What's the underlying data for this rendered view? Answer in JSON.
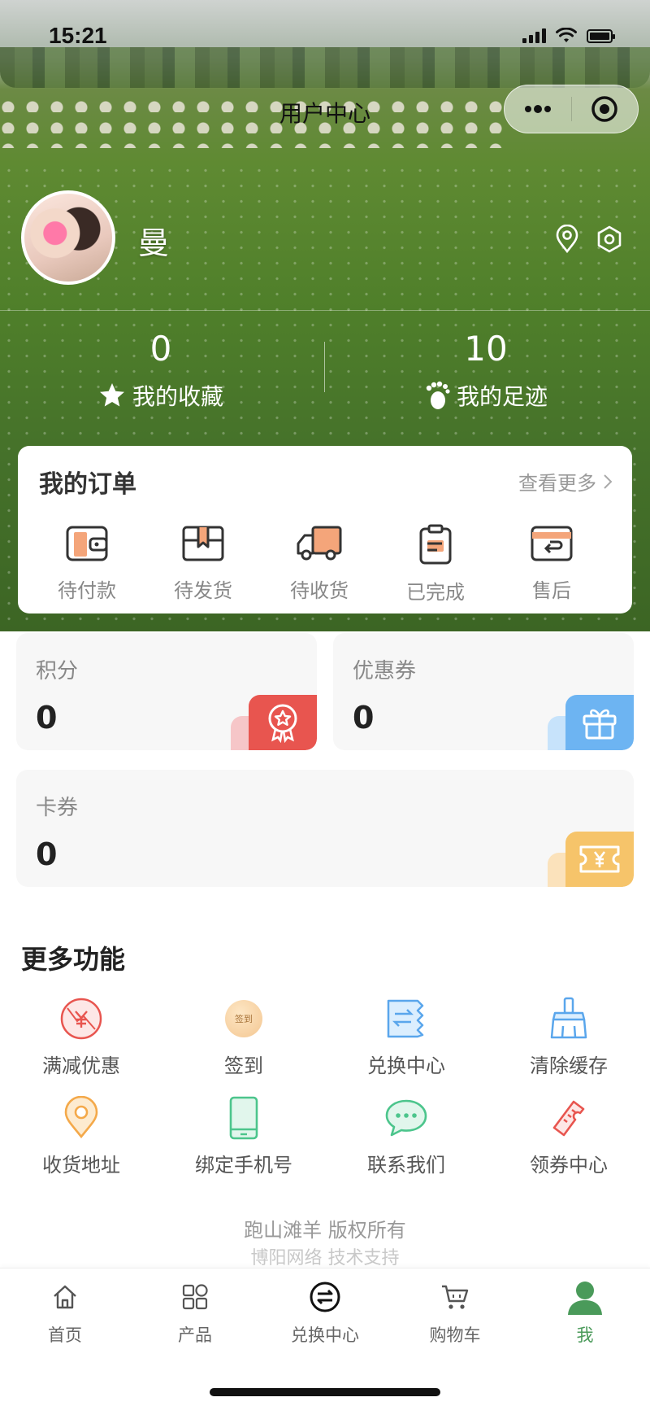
{
  "status_bar": {
    "time": "15:21"
  },
  "nav": {
    "title": "用户中心",
    "menu_icon": "more-dots-icon",
    "close_icon": "target-circle-icon"
  },
  "profile": {
    "name": "曼",
    "location_icon": "location-pin-icon",
    "settings_icon": "hexagon-gear-icon"
  },
  "stats": {
    "favorites": {
      "value": "0",
      "label": "我的收藏",
      "icon": "star-icon"
    },
    "footprints": {
      "value": "10",
      "label": "我的足迹",
      "icon": "footprint-icon"
    }
  },
  "orders": {
    "title": "我的订单",
    "more_label": "查看更多",
    "items": [
      {
        "label": "待付款",
        "icon": "wallet-icon"
      },
      {
        "label": "待发货",
        "icon": "box-icon"
      },
      {
        "label": "待收货",
        "icon": "truck-icon"
      },
      {
        "label": "已完成",
        "icon": "clipboard-icon"
      },
      {
        "label": "售后",
        "icon": "return-card-icon"
      }
    ]
  },
  "assets": {
    "points": {
      "label": "积分",
      "value": "0",
      "color": "#e8554f"
    },
    "coupons": {
      "label": "优惠券",
      "value": "0",
      "color": "#6db4f2"
    },
    "cards": {
      "label": "卡券",
      "value": "0",
      "color": "#f6c46a"
    }
  },
  "more_functions": {
    "title": "更多功能",
    "items": [
      {
        "label": "满减优惠",
        "icon": "discount-icon"
      },
      {
        "label": "签到",
        "icon": "checkin-icon",
        "badge_text": "签到"
      },
      {
        "label": "兑换中心",
        "icon": "exchange-ticket-icon"
      },
      {
        "label": "清除缓存",
        "icon": "broom-icon"
      },
      {
        "label": "收货地址",
        "icon": "location-pin-icon"
      },
      {
        "label": "绑定手机号",
        "icon": "phone-icon"
      },
      {
        "label": "联系我们",
        "icon": "chat-bubble-icon"
      },
      {
        "label": "领券中心",
        "icon": "ticket-icon"
      }
    ]
  },
  "footer": {
    "copyright": "跑山滩羊 版权所有",
    "tech_support": "博阳网络 技术支持"
  },
  "tabbar": {
    "items": [
      {
        "label": "首页",
        "icon": "home-icon"
      },
      {
        "label": "产品",
        "icon": "grid-icon"
      },
      {
        "label": "兑换中心",
        "icon": "exchange-icon"
      },
      {
        "label": "购物车",
        "icon": "cart-icon"
      },
      {
        "label": "我",
        "icon": "user-icon",
        "active": true
      }
    ],
    "active_color": "#4a9a5a"
  }
}
